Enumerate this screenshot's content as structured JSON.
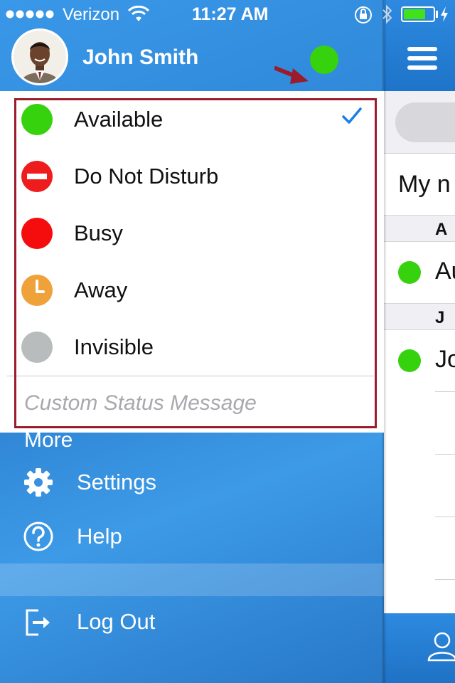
{
  "status_bar": {
    "carrier": "Verizon",
    "time": "11:27 AM"
  },
  "profile": {
    "name": "John Smith",
    "status_color": "#37d20e"
  },
  "statuses": [
    {
      "label": "Available",
      "color": "#37d20e",
      "icon": "green-dot-icon",
      "selected": true
    },
    {
      "label": "Do Not Disturb",
      "color": "#ee1c1c",
      "icon": "do-not-disturb-icon",
      "selected": false
    },
    {
      "label": "Busy",
      "color": "#f50d0d",
      "icon": "red-dot-icon",
      "selected": false
    },
    {
      "label": "Away",
      "color": "#f0a23a",
      "icon": "clock-icon",
      "selected": false
    },
    {
      "label": "Invisible",
      "color": "#b9bcbd",
      "icon": "gray-dot-icon",
      "selected": false
    }
  ],
  "custom_status": {
    "placeholder": "Custom Status Message"
  },
  "more": {
    "label": "More",
    "items": [
      {
        "label": "Settings",
        "icon": "gear-icon"
      },
      {
        "label": "Help",
        "icon": "help-icon"
      },
      {
        "label": "Log Out",
        "icon": "logout-icon"
      }
    ]
  },
  "main": {
    "section_title": "My n",
    "sections": [
      {
        "letter": "A",
        "contact": "Au"
      },
      {
        "letter": "J",
        "contact": "Jo"
      }
    ]
  },
  "colors": {
    "accent": "#2a7fd0",
    "annotation": "#9b1c2a"
  }
}
